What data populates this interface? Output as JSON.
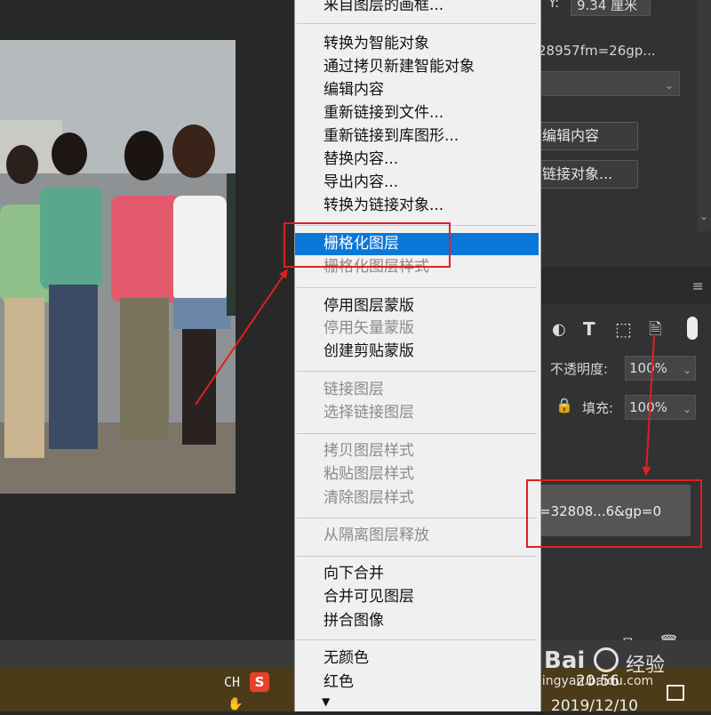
{
  "context_menu": {
    "top_cut_label": "来自图层的画框...",
    "items": [
      {
        "label": "转换为智能对象",
        "disabled": false
      },
      {
        "label": "通过拷贝新建智能对象",
        "disabled": false
      },
      {
        "label": "编辑内容",
        "disabled": false
      },
      {
        "label": "重新链接到文件...",
        "disabled": false
      },
      {
        "label": "重新链接到库图形...",
        "disabled": false
      },
      {
        "label": "替换内容...",
        "disabled": false
      },
      {
        "label": "导出内容...",
        "disabled": false
      },
      {
        "label": "转换为链接对象...",
        "disabled": false
      },
      {
        "label": "栅格化图层",
        "disabled": false,
        "selected": true
      },
      {
        "label": "栅格化图层样式",
        "disabled": true
      },
      {
        "label": "停用图层蒙版",
        "disabled": false
      },
      {
        "label": "停用矢量蒙版",
        "disabled": true
      },
      {
        "label": "创建剪贴蒙版",
        "disabled": false
      },
      {
        "label": "链接图层",
        "disabled": true
      },
      {
        "label": "选择链接图层",
        "disabled": true
      },
      {
        "label": "拷贝图层样式",
        "disabled": true
      },
      {
        "label": "粘贴图层样式",
        "disabled": true
      },
      {
        "label": "清除图层样式",
        "disabled": true
      },
      {
        "label": "从隔离图层释放",
        "disabled": true
      },
      {
        "label": "向下合并",
        "disabled": false
      },
      {
        "label": "合并可见图层",
        "disabled": false
      },
      {
        "label": "拼合图像",
        "disabled": false
      },
      {
        "label": "无颜色",
        "disabled": false
      },
      {
        "label": "红色",
        "disabled": false
      }
    ],
    "more_arrow": "▼"
  },
  "properties": {
    "y_label": "Y:",
    "y_value": "9.34 厘米",
    "filename": "28957fm=26gp...",
    "edit_contents_btn": "编辑内容",
    "convert_link_btn": "链接对象..."
  },
  "layers": {
    "opacity_label": "不透明度:",
    "opacity_value": "100%",
    "fill_label": "填充:",
    "fill_value": "100%",
    "layer_name": "=32808...6&gp=0"
  },
  "taskbar": {
    "ime": "CH",
    "sogou": "S",
    "time": "20:56",
    "date": "2019/12/10"
  },
  "watermark": {
    "brand": "Bai",
    "brand2": "经验",
    "url": "jingyan.baidu.com"
  },
  "colors": {
    "menu_selected": "#0b77d8",
    "annotation": "#e02020"
  }
}
